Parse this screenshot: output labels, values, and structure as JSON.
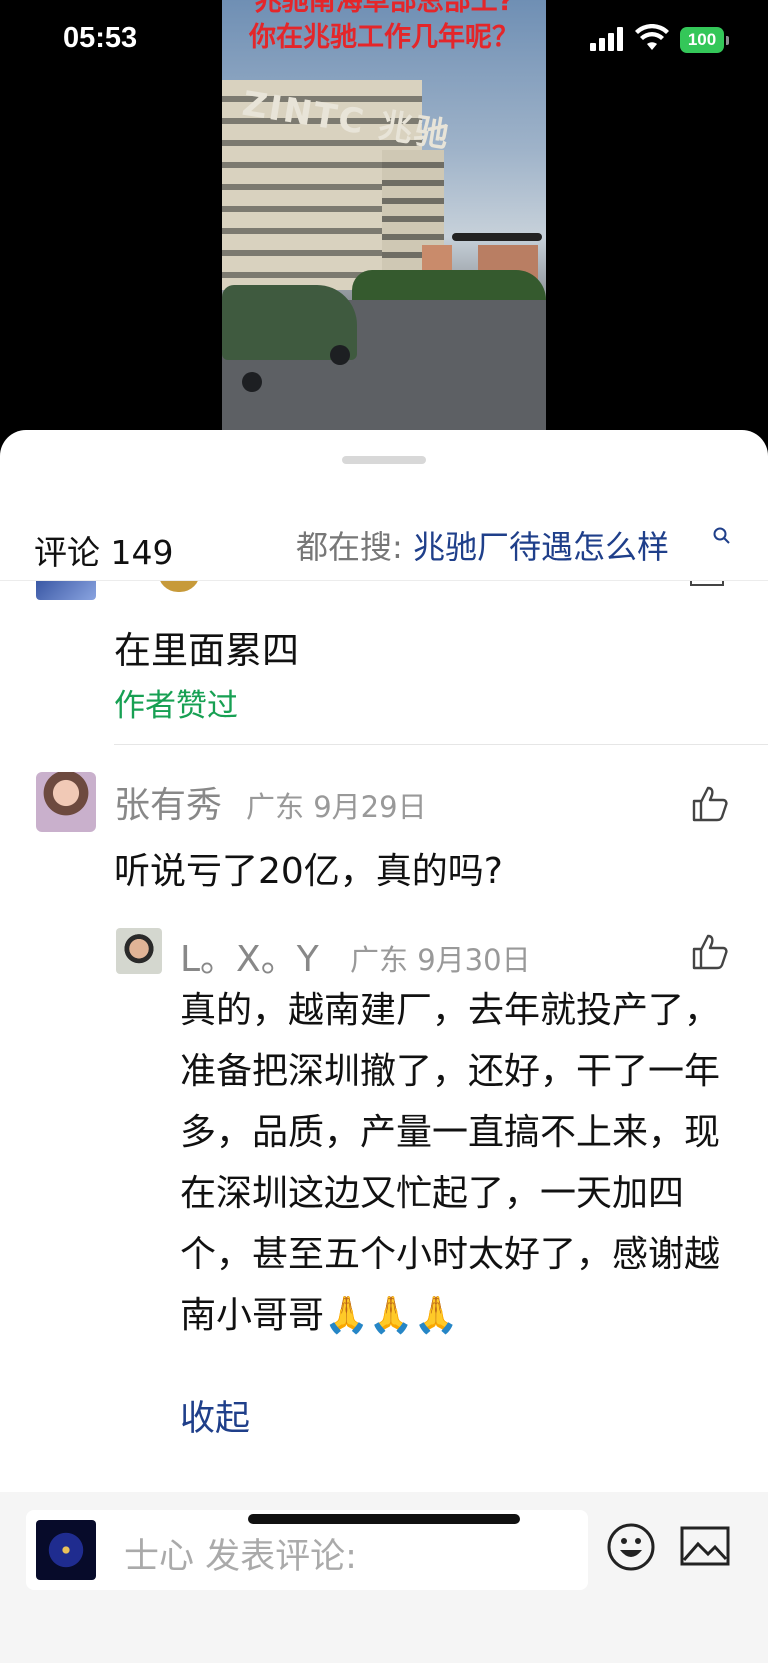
{
  "status_bar": {
    "time": "05:53",
    "battery": "100"
  },
  "video": {
    "caption_line1": "兆驰南海草部总部工?",
    "caption_line2": "你在兆驰工作几年呢？",
    "logo": "ZINTC 兆驰"
  },
  "comments_header": {
    "count_label": "评论 149",
    "search_prefix": "都在搜: ",
    "search_query": "兆驰厂待遇怎么样"
  },
  "comments": [
    {
      "text": "在里面累四",
      "tag": "作者赞过"
    },
    {
      "author": "张有秀",
      "region_date": "广东 9月29日",
      "text": "听说亏了20亿，真的吗?",
      "replies": [
        {
          "author": "L。X。Y",
          "region_date": "广东 9月30日",
          "text": "真的，越南建厂，去年就投产了，准备把深圳撤了，还好，干了一年多，品质，产量一直搞不上来，现在深圳这边又忙起了，一天加四个，甚至五个小时太好了，感谢越南小哥哥🙏🙏🙏"
        }
      ],
      "collapse_label": "收起"
    }
  ],
  "input_bar": {
    "placeholder": "士心 发表评论:"
  },
  "icons": {
    "like": "thumbs-up-icon",
    "emoji": "smiley-icon",
    "image": "image-icon",
    "search": "search-icon"
  },
  "colors": {
    "link_blue": "#1f3f8a",
    "author_liked_green": "#17a053",
    "battery_green": "#34c759",
    "caption_red": "#e4262a"
  }
}
